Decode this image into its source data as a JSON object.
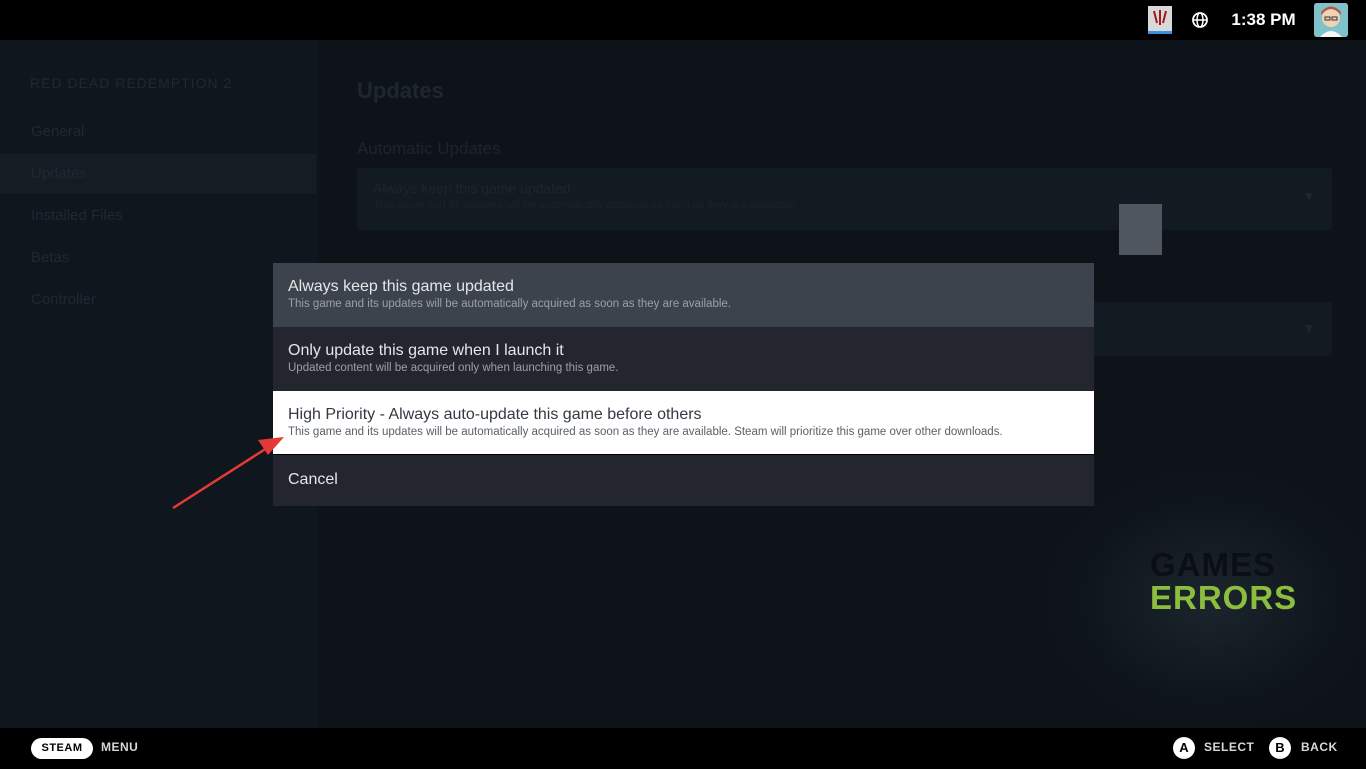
{
  "status_bar": {
    "clock": "1:38 PM",
    "game_icon": "game-icon",
    "network_icon": "globe-icon",
    "avatar_icon": "avatar"
  },
  "background": {
    "sidebar": {
      "game_title": "RED DEAD REDEMPTION 2",
      "items": [
        "General",
        "Updates",
        "Installed Files",
        "Betas",
        "Controller"
      ],
      "active_index": 1
    },
    "main": {
      "heading": "Updates",
      "section_label": "Automatic Updates",
      "dropdown_value": "Always keep this game updated",
      "dropdown_desc": "This game and its updates will be automatically acquired as soon as they are available."
    }
  },
  "modal": {
    "options": [
      {
        "title": "Always keep this game updated",
        "desc": "This game and its updates will be automatically acquired as soon as they are available."
      },
      {
        "title": "Only update this game when I launch it",
        "desc": "Updated content will be acquired only when launching this game."
      },
      {
        "title": "High Priority - Always auto-update this game before others",
        "desc": "This game and its updates will be automatically acquired as soon as they are available. Steam will prioritize this game over other downloads."
      }
    ],
    "cancel_label": "Cancel",
    "highlighted_index": 2
  },
  "watermark": {
    "line1": "GAMES",
    "line2": "ERRORS"
  },
  "bottom_bar": {
    "steam_label": "STEAM",
    "menu_label": "MENU",
    "a_button": "A",
    "select_label": "SELECT",
    "b_button": "B",
    "back_label": "BACK"
  },
  "colors": {
    "accent_arrow": "#e53935",
    "brand_green": "#8bbd3e"
  }
}
